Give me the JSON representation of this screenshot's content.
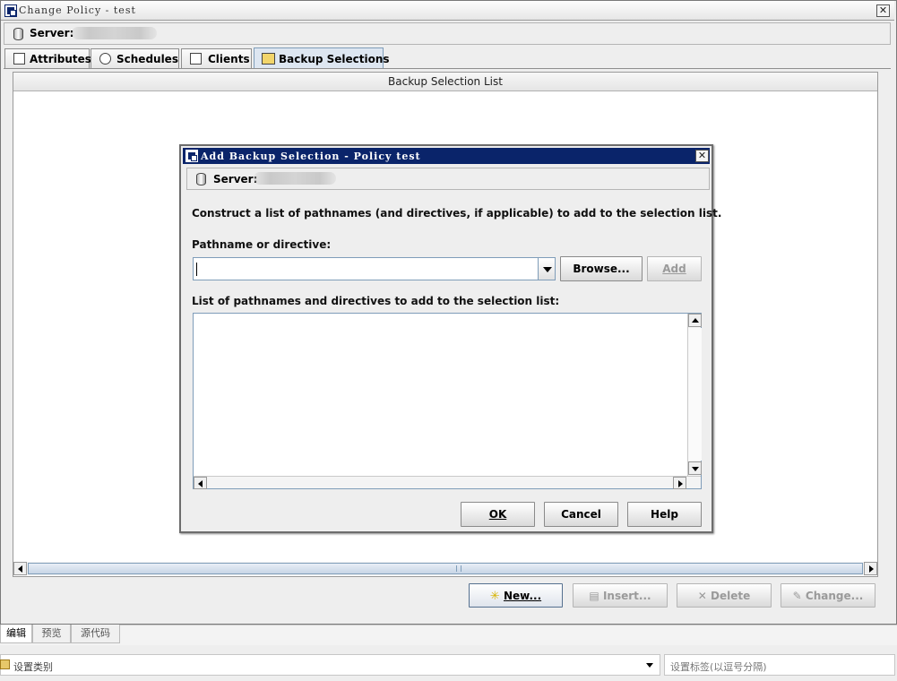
{
  "window": {
    "title": "Change Policy - test",
    "server_label": "Server:"
  },
  "tabs": [
    {
      "label": "Attributes",
      "icon": "attributes-icon"
    },
    {
      "label": "Schedules",
      "icon": "schedules-icon"
    },
    {
      "label": "Clients",
      "icon": "clients-icon"
    },
    {
      "label": "Backup Selections",
      "icon": "backup-selections-icon",
      "active": true
    }
  ],
  "selection_list": {
    "header": "Backup Selection List"
  },
  "actions": {
    "new": "New...",
    "insert": "Insert...",
    "delete": "Delete",
    "change": "Change..."
  },
  "dialog": {
    "title": "Add Backup Selection - Policy test",
    "server_label": "Server:",
    "instruction": "Construct a list of pathnames (and directives, if applicable) to add to the selection list.",
    "pathname_label": "Pathname or directive:",
    "pathname_value": "",
    "browse": "Browse...",
    "add": "Add",
    "list_label": "List of pathnames and directives to add to the selection list:",
    "ok": "OK",
    "cancel": "Cancel",
    "help": "Help"
  },
  "editor_tabs": [
    "编辑",
    "预览",
    "源代码"
  ],
  "category": {
    "placeholder": "设置类别"
  },
  "tags": {
    "placeholder": "设置标签(以逗号分隔)"
  },
  "colors": {
    "dialog_titlebar": "#0a246a",
    "active_tab": "#dde6f1",
    "scroll_thumb": "#c7d5e6"
  }
}
